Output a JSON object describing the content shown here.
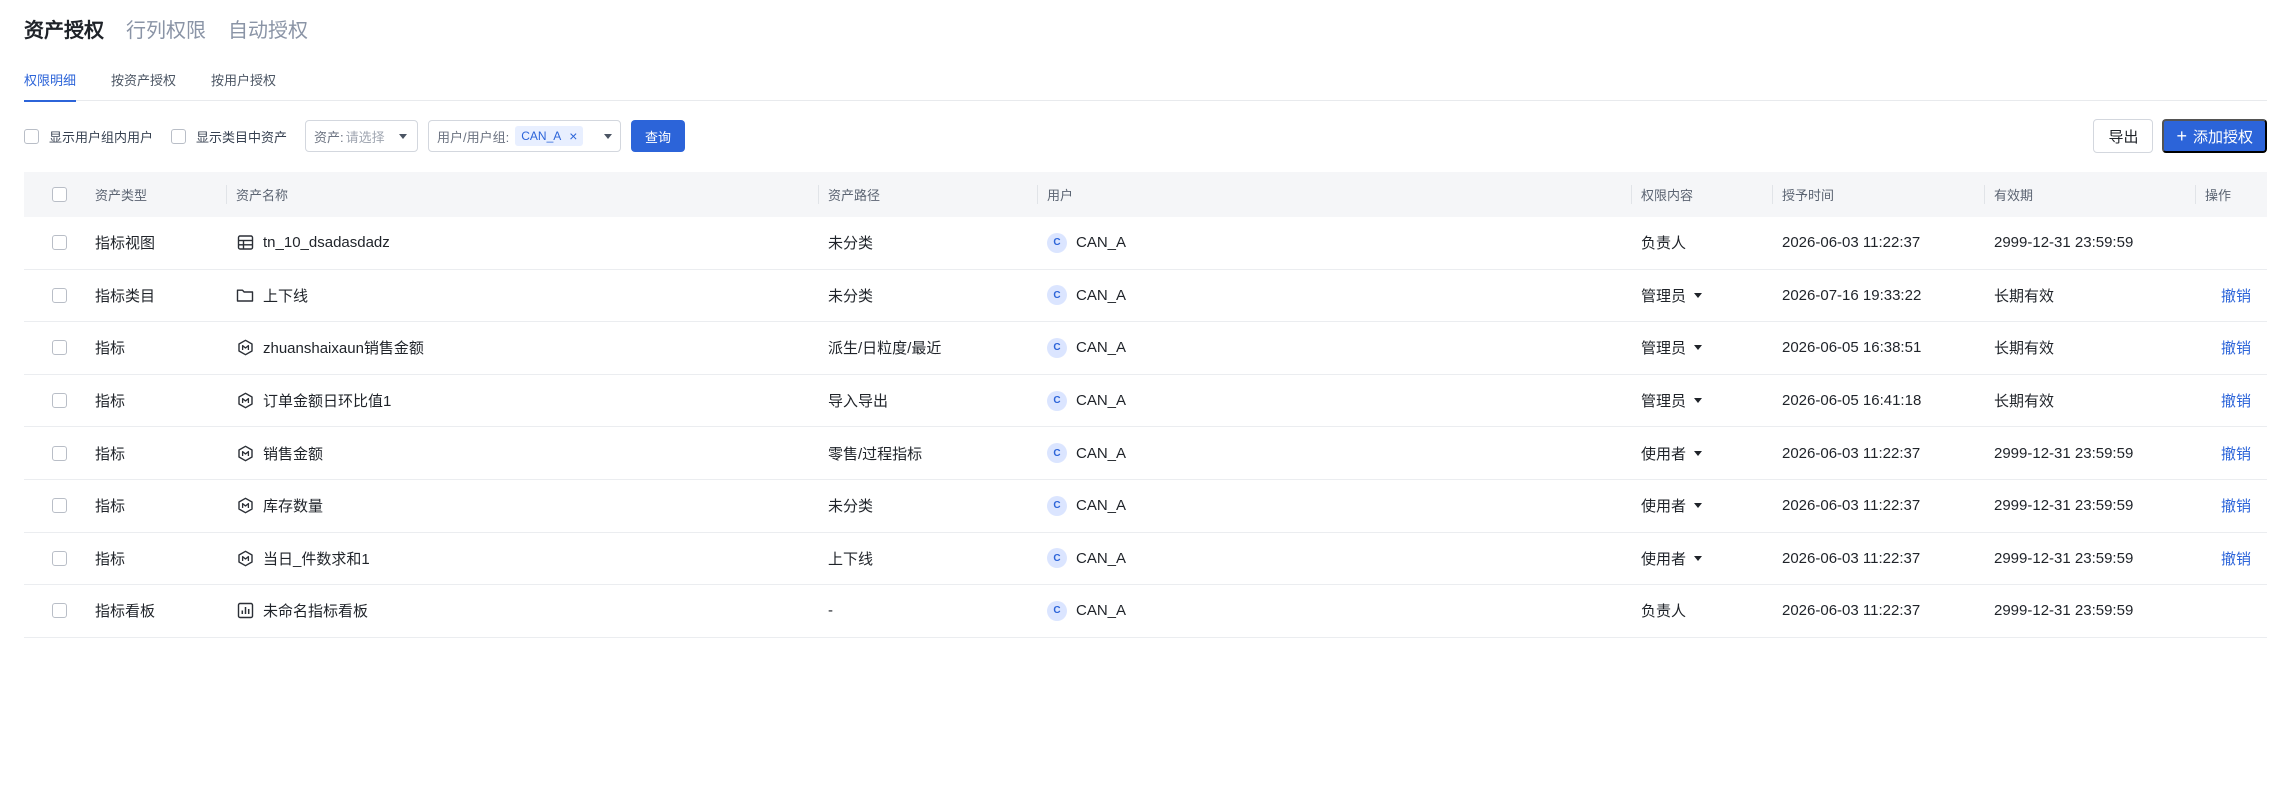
{
  "top_tabs": [
    {
      "label": "资产授权",
      "active": true
    },
    {
      "label": "行列权限",
      "active": false
    },
    {
      "label": "自动授权",
      "active": false
    }
  ],
  "sub_tabs": [
    {
      "label": "权限明细",
      "active": true
    },
    {
      "label": "按资产授权",
      "active": false
    },
    {
      "label": "按用户授权",
      "active": false
    }
  ],
  "filters": {
    "show_group_users": "显示用户组内用户",
    "show_category_assets": "显示类目中资产",
    "asset_prefix": "资产:",
    "asset_placeholder": "请选择",
    "user_prefix": "用户/用户组:",
    "user_tag": "CAN_A",
    "query_label": "查询"
  },
  "actions": {
    "export_label": "导出",
    "add_label": "添加授权"
  },
  "table": {
    "headers": [
      "资产类型",
      "资产名称",
      "资产路径",
      "用户",
      "权限内容",
      "授予时间",
      "有效期",
      "操作"
    ],
    "rows": [
      {
        "type": "指标视图",
        "icon": "table-icon",
        "name": "tn_10_dsadasdadz",
        "path": "未分类",
        "avatar": "C",
        "user": "CAN_A",
        "perm": "负责人",
        "perm_dropdown": false,
        "granted": "2026-06-03 11:22:37",
        "validity": "2999-12-31 23:59:59",
        "op": ""
      },
      {
        "type": "指标类目",
        "icon": "folder-icon",
        "name": "上下线",
        "path": "未分类",
        "avatar": "C",
        "user": "CAN_A",
        "perm": "管理员",
        "perm_dropdown": true,
        "granted": "2026-07-16 19:33:22",
        "validity": "长期有效",
        "op": "撤销"
      },
      {
        "type": "指标",
        "icon": "metric-icon",
        "name": "zhuanshaixaun销售金额",
        "path": "派生/日粒度/最近",
        "avatar": "C",
        "user": "CAN_A",
        "perm": "管理员",
        "perm_dropdown": true,
        "granted": "2026-06-05 16:38:51",
        "validity": "长期有效",
        "op": "撤销"
      },
      {
        "type": "指标",
        "icon": "metric-icon",
        "name": "订单金额日环比值1",
        "path": "导入导出",
        "avatar": "C",
        "user": "CAN_A",
        "perm": "管理员",
        "perm_dropdown": true,
        "granted": "2026-06-05 16:41:18",
        "validity": "长期有效",
        "op": "撤销"
      },
      {
        "type": "指标",
        "icon": "metric-icon",
        "name": "销售金额",
        "path": "零售/过程指标",
        "avatar": "C",
        "user": "CAN_A",
        "perm": "使用者",
        "perm_dropdown": true,
        "granted": "2026-06-03 11:22:37",
        "validity": "2999-12-31 23:59:59",
        "op": "撤销"
      },
      {
        "type": "指标",
        "icon": "metric-icon",
        "name": "库存数量",
        "path": "未分类",
        "avatar": "C",
        "user": "CAN_A",
        "perm": "使用者",
        "perm_dropdown": true,
        "granted": "2026-06-03 11:22:37",
        "validity": "2999-12-31 23:59:59",
        "op": "撤销"
      },
      {
        "type": "指标",
        "icon": "metric-icon",
        "name": "当日_件数求和1",
        "path": "上下线",
        "avatar": "C",
        "user": "CAN_A",
        "perm": "使用者",
        "perm_dropdown": true,
        "granted": "2026-06-03 11:22:37",
        "validity": "2999-12-31 23:59:59",
        "op": "撤销"
      },
      {
        "type": "指标看板",
        "icon": "dashboard-icon",
        "name": "未命名指标看板",
        "path": "-",
        "avatar": "C",
        "user": "CAN_A",
        "perm": "负责人",
        "perm_dropdown": false,
        "granted": "2026-06-03 11:22:37",
        "validity": "2999-12-31 23:59:59",
        "op": ""
      }
    ]
  },
  "colors": {
    "accent": "#2c64d9",
    "header_bg": "#f5f6f8",
    "border": "#ebedf0"
  }
}
